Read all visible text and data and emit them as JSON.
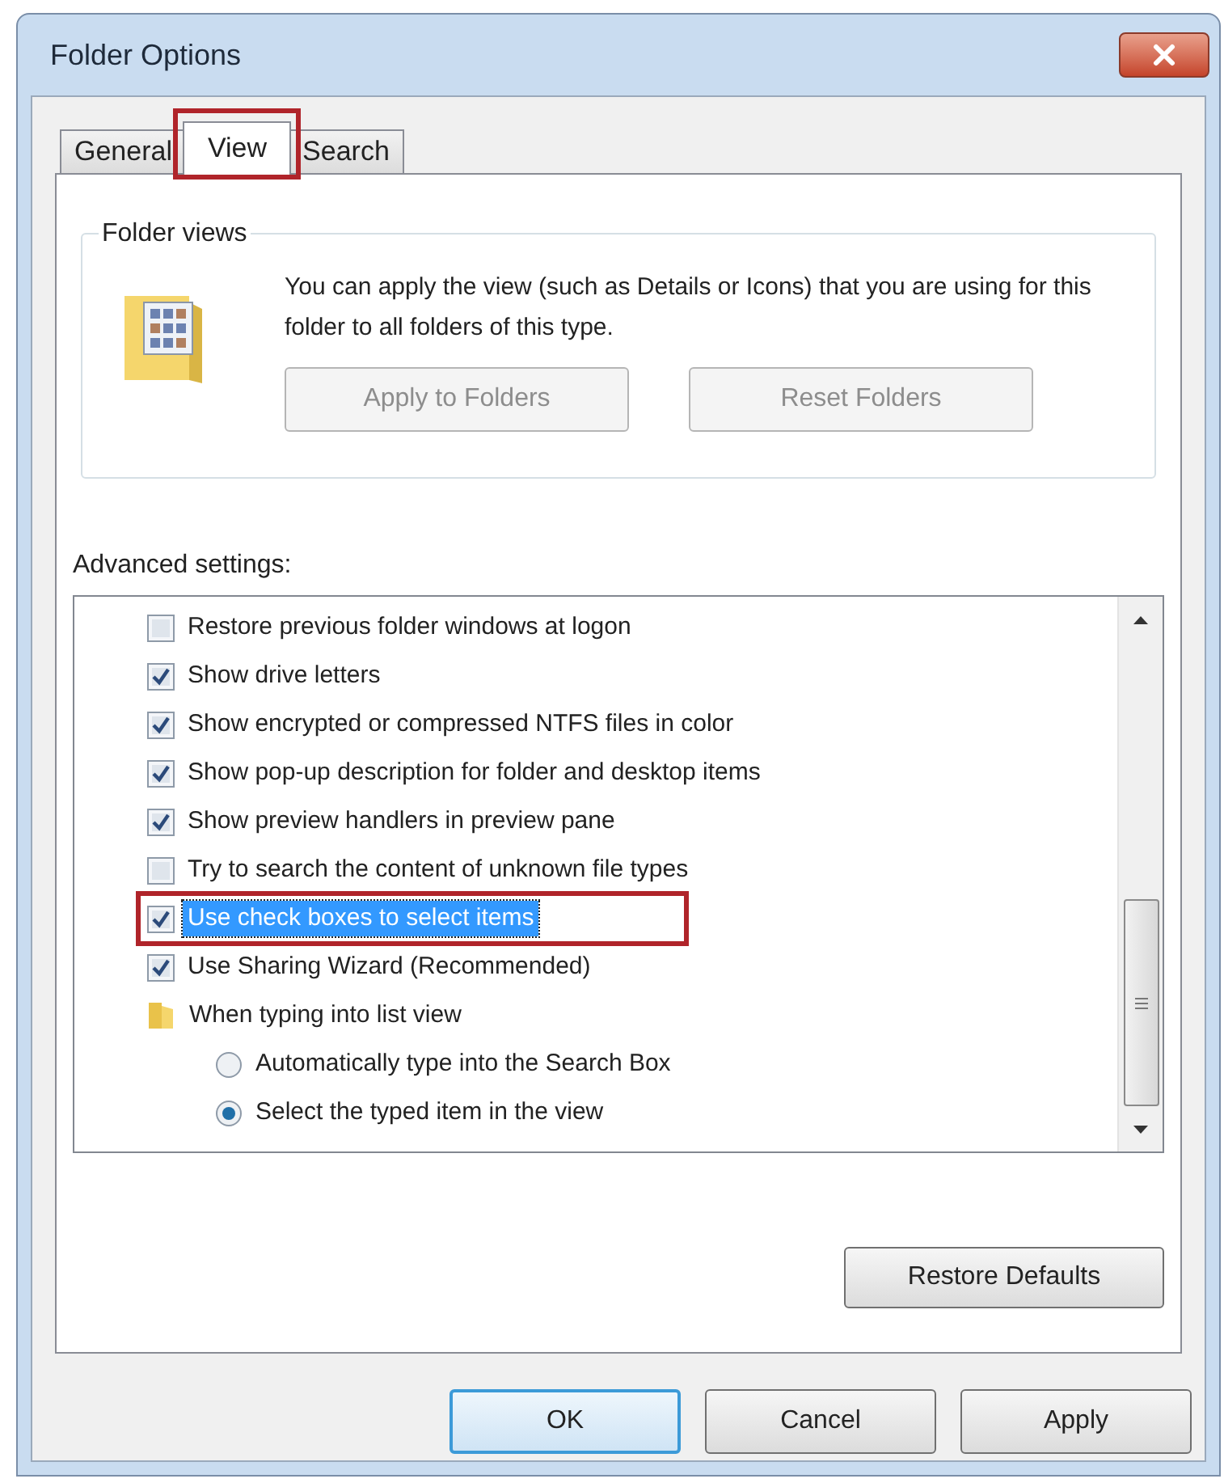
{
  "window": {
    "title": "Folder Options"
  },
  "tabs": [
    {
      "label": "General",
      "selected": false,
      "annotated": false
    },
    {
      "label": "View",
      "selected": true,
      "annotated": true
    },
    {
      "label": "Search",
      "selected": false,
      "annotated": false
    }
  ],
  "folder_views": {
    "legend": "Folder views",
    "description": "You can apply the view (such as Details or Icons) that you are using for this folder to all folders of this type.",
    "buttons": [
      {
        "label": "Apply to Folders",
        "disabled": true
      },
      {
        "label": "Reset Folders",
        "disabled": true
      }
    ]
  },
  "advanced_settings": {
    "label": "Advanced settings:",
    "items": [
      {
        "kind": "checkbox",
        "label": "Restore previous folder windows at logon",
        "checked": false,
        "selected": false,
        "annotated": false
      },
      {
        "kind": "checkbox",
        "label": "Show drive letters",
        "checked": true,
        "selected": false,
        "annotated": false
      },
      {
        "kind": "checkbox",
        "label": "Show encrypted or compressed NTFS files in color",
        "checked": true,
        "selected": false,
        "annotated": false
      },
      {
        "kind": "checkbox",
        "label": "Show pop-up description for folder and desktop items",
        "checked": true,
        "selected": false,
        "annotated": false
      },
      {
        "kind": "checkbox",
        "label": "Show preview handlers in preview pane",
        "checked": true,
        "selected": false,
        "annotated": false
      },
      {
        "kind": "checkbox",
        "label": "Try to search the content of unknown file types",
        "checked": false,
        "selected": false,
        "annotated": false
      },
      {
        "kind": "checkbox",
        "label": "Use check boxes to select items",
        "checked": true,
        "selected": true,
        "annotated": true
      },
      {
        "kind": "checkbox",
        "label": "Use Sharing Wizard (Recommended)",
        "checked": true,
        "selected": false,
        "annotated": false
      },
      {
        "kind": "group",
        "label": "When typing into list view"
      },
      {
        "kind": "radio",
        "label": "Automatically type into the Search Box",
        "checked": false,
        "selected": false,
        "annotated": false
      },
      {
        "kind": "radio",
        "label": "Select the typed item in the view",
        "checked": true,
        "selected": false,
        "annotated": false
      }
    ]
  },
  "restore_defaults": {
    "label": "Restore Defaults"
  },
  "buttons": [
    {
      "label": "OK",
      "default": true
    },
    {
      "label": "Cancel",
      "default": false
    },
    {
      "label": "Apply",
      "default": false
    }
  ]
}
